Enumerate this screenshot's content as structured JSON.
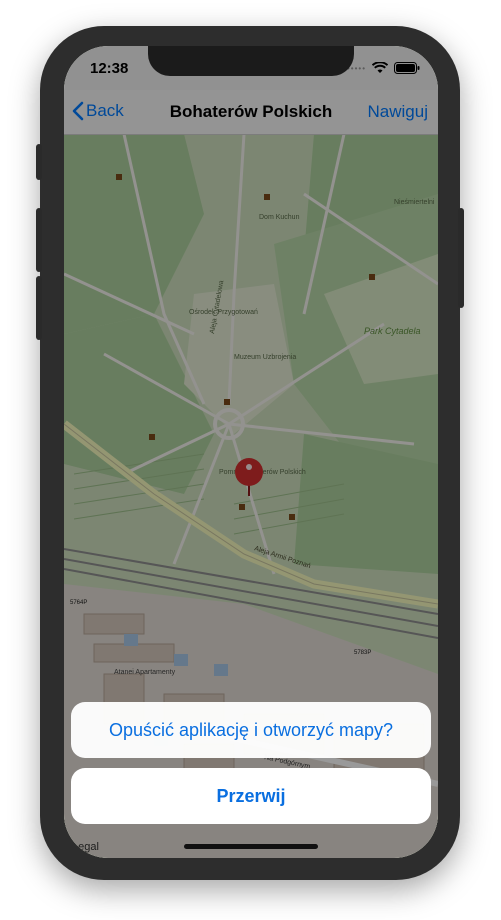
{
  "status_bar": {
    "time": "12:38",
    "signal_dots": "•••••",
    "icons": [
      "wifi-icon",
      "battery-icon"
    ]
  },
  "nav_bar": {
    "back_label": "Back",
    "title": "Bohaterów Polskich",
    "right_label": "Nawiguj"
  },
  "map": {
    "labels": [
      "Park Cytadela",
      "Aleja Armii Poznań",
      "Na Podgórnym",
      "Atanei Apartamenty",
      "Muzeum Uzbrojenia",
      "Ośrodek Przygotowań",
      "Aleja Cytadelowa",
      "Dom Kuchun",
      "Nieśmiertelni",
      "Pomnik Bohaterów Polskich",
      "5764P",
      "5783P"
    ],
    "legal_label": "Legal",
    "pin_icon": "location-pin-icon"
  },
  "action_sheet": {
    "title": "Opuścić aplikację i otworzyć mapy?",
    "cancel_label": "Przerwij"
  },
  "colors": {
    "accent": "#0a6fe0",
    "pin": "#d32f2f"
  }
}
